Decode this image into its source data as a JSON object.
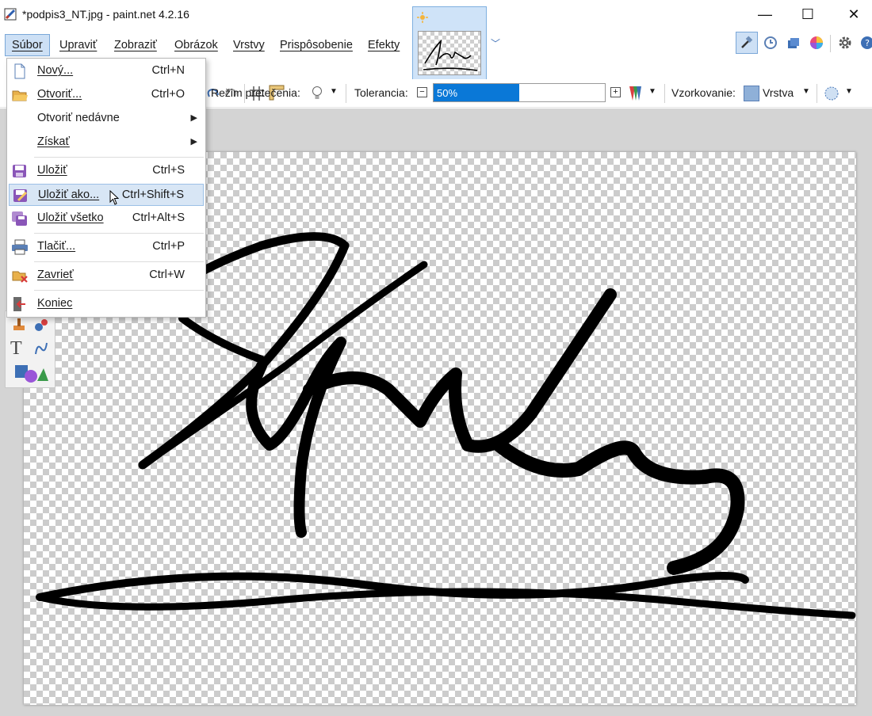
{
  "window": {
    "title": "*podpis3_NT.jpg - paint.net 4.2.16",
    "minimize_glyph": "—",
    "maximize_glyph": "☐",
    "close_glyph": "✕"
  },
  "menubar": {
    "items": [
      "Súbor",
      "Upraviť",
      "Zobraziť",
      "Obrázok",
      "Vrstvy",
      "Prispôsobenie",
      "Efekty"
    ],
    "active_index": 0
  },
  "toolbar": {
    "overflow_mode_label": "Režim pretečenia:",
    "tolerance_label": "Tolerancia:",
    "tolerance_value": "50%",
    "tolerance_percent": 50,
    "sampling_label": "Vzorkovanie:",
    "sampling_value": "Vrstva"
  },
  "file_menu": {
    "items": [
      {
        "label": "Nový...",
        "shortcut": "Ctrl+N",
        "icon": "new-document-icon"
      },
      {
        "label": "Otvoriť...",
        "shortcut": "Ctrl+O",
        "icon": "open-folder-icon"
      },
      {
        "label": "Otvoriť nedávne",
        "shortcut": "",
        "submenu": true
      },
      {
        "label": "Získať",
        "shortcut": "",
        "submenu": true
      },
      {
        "label": "Uložiť",
        "shortcut": "Ctrl+S",
        "icon": "save-icon"
      },
      {
        "label": "Uložiť ako...",
        "shortcut": "Ctrl+Shift+S",
        "icon": "save-as-icon",
        "highlighted": true
      },
      {
        "label": "Uložiť všetko",
        "shortcut": "Ctrl+Alt+S",
        "icon": "save-all-icon"
      },
      {
        "label": "Tlačiť...",
        "shortcut": "Ctrl+P",
        "icon": "print-icon"
      },
      {
        "label": "Zavrieť",
        "shortcut": "Ctrl+W",
        "icon": "close-document-icon"
      },
      {
        "label": "Koniec",
        "shortcut": "",
        "icon": "exit-icon"
      }
    ]
  },
  "colors": {
    "accent": "#0a78d7",
    "menu_highlight": "#d8e6f5",
    "sampling_swatch": "#8fb0d8"
  }
}
